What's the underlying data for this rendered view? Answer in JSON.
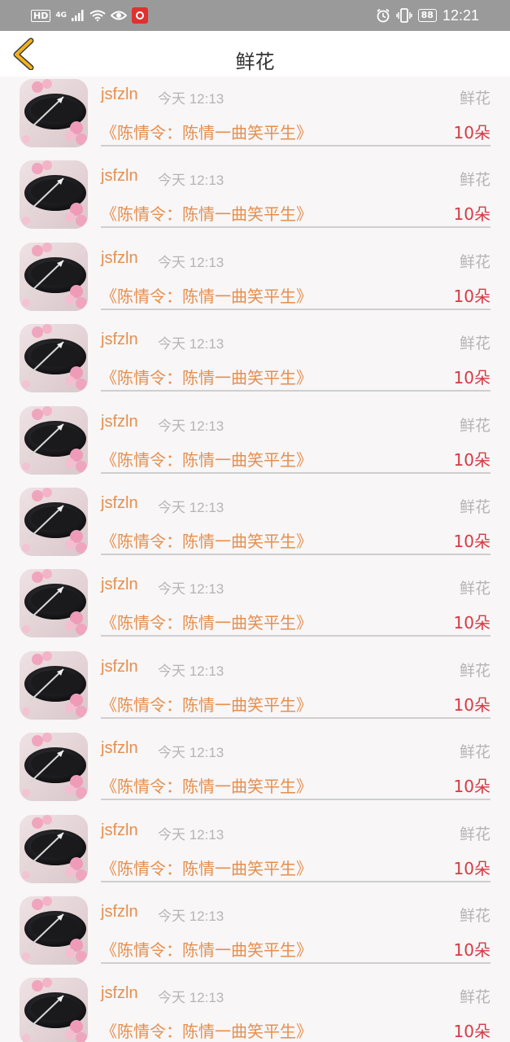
{
  "status_bar": {
    "hd": "HD",
    "network": "4G",
    "battery": "88",
    "time": "12:21"
  },
  "header": {
    "title": "鲜花",
    "back_icon": "back-chevron-icon"
  },
  "colors": {
    "accent_orange": "#e58f4e",
    "quantity_red": "#d73a43",
    "muted_gray": "#b5b5b5",
    "back_yellow": "#f2b21b"
  },
  "gifts": [
    {
      "user": "jsfzln",
      "time": "今天 12:13",
      "tag": "鲜花",
      "work": "《陈情令：陈情一曲笑平生》",
      "quantity": "10朵"
    },
    {
      "user": "jsfzln",
      "time": "今天 12:13",
      "tag": "鲜花",
      "work": "《陈情令：陈情一曲笑平生》",
      "quantity": "10朵"
    },
    {
      "user": "jsfzln",
      "time": "今天 12:13",
      "tag": "鲜花",
      "work": "《陈情令：陈情一曲笑平生》",
      "quantity": "10朵"
    },
    {
      "user": "jsfzln",
      "time": "今天 12:13",
      "tag": "鲜花",
      "work": "《陈情令：陈情一曲笑平生》",
      "quantity": "10朵"
    },
    {
      "user": "jsfzln",
      "time": "今天 12:13",
      "tag": "鲜花",
      "work": "《陈情令：陈情一曲笑平生》",
      "quantity": "10朵"
    },
    {
      "user": "jsfzln",
      "time": "今天 12:13",
      "tag": "鲜花",
      "work": "《陈情令：陈情一曲笑平生》",
      "quantity": "10朵"
    },
    {
      "user": "jsfzln",
      "time": "今天 12:13",
      "tag": "鲜花",
      "work": "《陈情令：陈情一曲笑平生》",
      "quantity": "10朵"
    },
    {
      "user": "jsfzln",
      "time": "今天 12:13",
      "tag": "鲜花",
      "work": "《陈情令：陈情一曲笑平生》",
      "quantity": "10朵"
    },
    {
      "user": "jsfzln",
      "time": "今天 12:13",
      "tag": "鲜花",
      "work": "《陈情令：陈情一曲笑平生》",
      "quantity": "10朵"
    },
    {
      "user": "jsfzln",
      "time": "今天 12:13",
      "tag": "鲜花",
      "work": "《陈情令：陈情一曲笑平生》",
      "quantity": "10朵"
    },
    {
      "user": "jsfzln",
      "time": "今天 12:13",
      "tag": "鲜花",
      "work": "《陈情令：陈情一曲笑平生》",
      "quantity": "10朵"
    },
    {
      "user": "jsfzln",
      "time": "今天 12:13",
      "tag": "鲜花",
      "work": "《陈情令：陈情一曲笑平生》",
      "quantity": "10朵"
    }
  ]
}
